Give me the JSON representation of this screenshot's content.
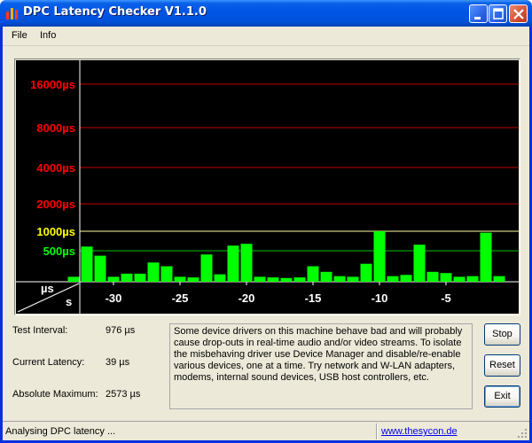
{
  "window": {
    "title": "DPC Latency Checker V1.1.0"
  },
  "menu": {
    "file": "File",
    "info": "Info"
  },
  "chart_data": {
    "type": "bar",
    "y_axis_labels": [
      {
        "text": "16000µs",
        "color": "#ff0000"
      },
      {
        "text": "8000µs",
        "color": "#ff0000"
      },
      {
        "text": "4000µs",
        "color": "#ff0000"
      },
      {
        "text": "2000µs",
        "color": "#ff0000"
      },
      {
        "text": "1000µs",
        "color": "#ffff00"
      },
      {
        "text": "500µs",
        "color": "#00ff00"
      }
    ],
    "corner_unit_top": "µs",
    "corner_unit_bottom": "s",
    "x_tick_labels": [
      "-30",
      "-25",
      "-20",
      "-15",
      "-10",
      "-5"
    ],
    "x_values": [
      -33,
      -32,
      -31,
      -30,
      -29,
      -28,
      -27,
      -26,
      -25,
      -24,
      -23,
      -22,
      -21,
      -20,
      -19,
      -18,
      -17,
      -16,
      -15,
      -14,
      -13,
      -12,
      -11,
      -10,
      -9,
      -8,
      -7,
      -6,
      -5,
      -4,
      -3,
      -2,
      -1
    ],
    "values_us": [
      80,
      580,
      420,
      80,
      130,
      130,
      310,
      250,
      80,
      70,
      440,
      120,
      600,
      640,
      80,
      70,
      60,
      70,
      250,
      160,
      90,
      80,
      290,
      1000,
      90,
      110,
      620,
      160,
      140,
      80,
      90,
      950,
      90
    ],
    "bar_color": "#00ff00",
    "grid": true,
    "background": "#000000"
  },
  "info": {
    "test_interval_label": "Test Interval:",
    "test_interval_value": "976 µs",
    "current_latency_label": "Current Latency:",
    "current_latency_value": "39 µs",
    "absolute_maximum_label": "Absolute Maximum:",
    "absolute_maximum_value": "2573 µs"
  },
  "message": "Some device drivers on this machine behave bad and will probably cause drop-outs in real-time audio and/or video streams. To isolate the misbehaving driver use Device Manager and disable/re-enable various devices, one at a time. Try network and W-LAN adapters, modems, internal sound devices, USB host controllers, etc.",
  "buttons": {
    "stop": "Stop",
    "reset": "Reset",
    "exit": "Exit"
  },
  "status": {
    "text": "Analysing DPC latency ...",
    "link": "www.thesycon.de"
  },
  "colors": {
    "titlebar": "#0055e5",
    "face": "#ece9d8",
    "chart_background": "#000000",
    "bars": "#00ff00"
  }
}
